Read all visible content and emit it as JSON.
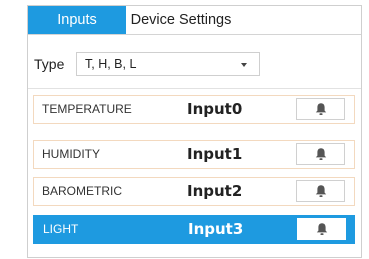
{
  "tabs": [
    {
      "label": "Inputs",
      "active": true
    },
    {
      "label": "Device Settings",
      "active": false
    }
  ],
  "type_selector": {
    "label": "Type",
    "value": "T, H, B, L"
  },
  "inputs": [
    {
      "label": "TEMPERATURE",
      "value": "Input0",
      "selected": false
    },
    {
      "label": "HUMIDITY",
      "value": "Input1",
      "selected": false
    },
    {
      "label": "BAROMETRIC",
      "value": "Input2",
      "selected": false
    },
    {
      "label": "LIGHT",
      "value": "Input3",
      "selected": true
    }
  ],
  "colors": {
    "accent": "#1e9ae0",
    "row_border": "#f3d9bf",
    "icon": "#555555"
  },
  "icons": {
    "alarm": "bell-icon",
    "dropdown": "chevron-down-icon"
  }
}
